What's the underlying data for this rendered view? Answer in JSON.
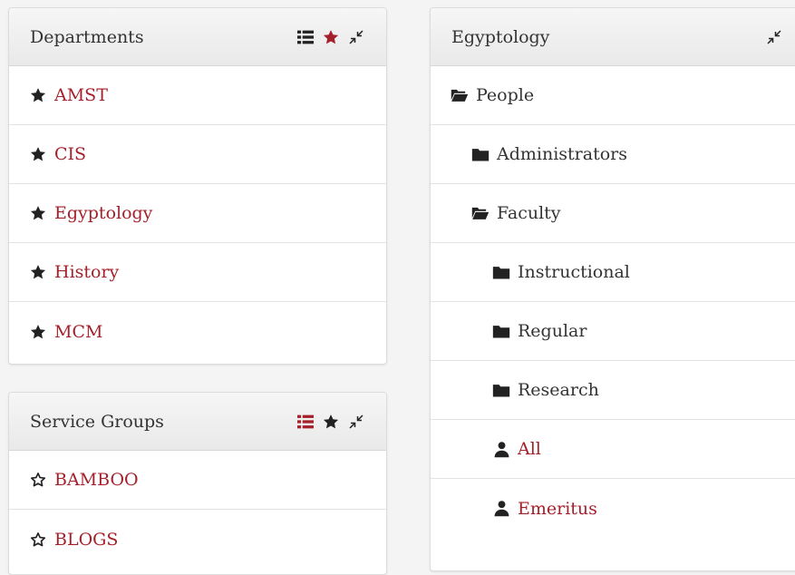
{
  "colors": {
    "accent": "#a4212b",
    "text": "#333333",
    "icon": "#222222"
  },
  "departments": {
    "title": "Departments",
    "header_icons": [
      {
        "name": "list-icon",
        "active": false
      },
      {
        "name": "star-icon",
        "active": true
      },
      {
        "name": "collapse-icon",
        "active": false
      }
    ],
    "items": [
      {
        "label": "AMST",
        "icon": "star-filled-icon"
      },
      {
        "label": "CIS",
        "icon": "star-filled-icon"
      },
      {
        "label": "Egyptology",
        "icon": "star-filled-icon"
      },
      {
        "label": "History",
        "icon": "star-filled-icon"
      },
      {
        "label": "MCM",
        "icon": "star-filled-icon"
      }
    ]
  },
  "service_groups": {
    "title": "Service Groups",
    "header_icons": [
      {
        "name": "list-icon",
        "active": true
      },
      {
        "name": "star-icon",
        "active": false
      },
      {
        "name": "collapse-icon",
        "active": false
      }
    ],
    "items": [
      {
        "label": "BAMBOO",
        "icon": "star-outline-icon"
      },
      {
        "label": "BLOGS",
        "icon": "star-outline-icon"
      }
    ]
  },
  "egyptology": {
    "title": "Egyptology",
    "header_icons": [
      {
        "name": "collapse-icon",
        "active": false
      }
    ],
    "tree": [
      {
        "label": "People",
        "icon": "folder-open-icon",
        "level": 0,
        "link": false
      },
      {
        "label": "Administrators",
        "icon": "folder-icon",
        "level": 1,
        "link": false
      },
      {
        "label": "Faculty",
        "icon": "folder-open-icon",
        "level": 1,
        "link": false
      },
      {
        "label": "Instructional",
        "icon": "folder-icon",
        "level": 2,
        "link": false
      },
      {
        "label": "Regular",
        "icon": "folder-icon",
        "level": 2,
        "link": false
      },
      {
        "label": "Research",
        "icon": "folder-icon",
        "level": 2,
        "link": false
      },
      {
        "label": "All",
        "icon": "user-icon",
        "level": 2,
        "link": true
      },
      {
        "label": "Emeritus",
        "icon": "user-icon",
        "level": 2,
        "link": true
      }
    ]
  }
}
